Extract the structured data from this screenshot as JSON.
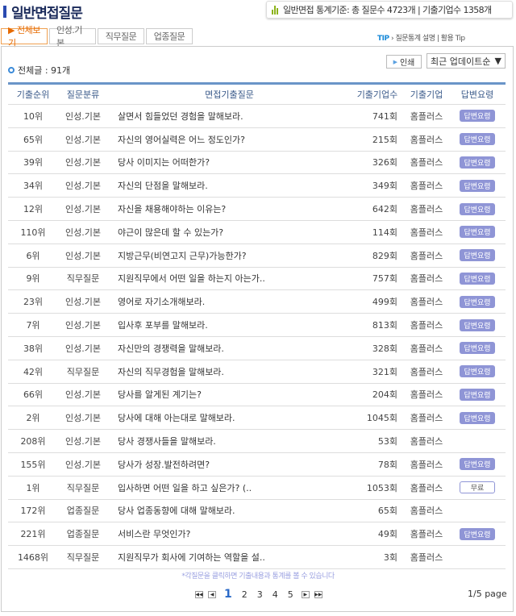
{
  "header": {
    "title": "일반면접질문",
    "stats": "일반면접 통계기준: 총 질문수 4723개 | 기출기업수 1358개"
  },
  "tabs": [
    {
      "label": "▶ 전체보기"
    },
    {
      "label": "인성.기본"
    },
    {
      "label": "직무질문"
    },
    {
      "label": "업종질문"
    }
  ],
  "tip": {
    "label": "TIP",
    "arrow": "›",
    "text": "질문통계 설명 | 활용 Tip"
  },
  "total": "전체글 : 91개",
  "print_label": "인쇄",
  "sort": {
    "selected": "최근 업데이트순"
  },
  "columns": [
    "기출순위",
    "질문분류",
    "면접기출질문",
    "기출기업수",
    "기출기업",
    "답변요령"
  ],
  "rows": [
    {
      "rank": "10위",
      "cat": "인성.기본",
      "q": "살면서 힘들었던 경험을 말해보라.",
      "count": "741회",
      "co": "홈플러스",
      "ans": "답변요령"
    },
    {
      "rank": "65위",
      "cat": "인성.기본",
      "q": "자신의 영어실력은 어느 정도인가?",
      "count": "215회",
      "co": "홈플러스",
      "ans": "답변요령"
    },
    {
      "rank": "39위",
      "cat": "인성.기본",
      "q": "당사 이미지는 어떠한가?",
      "count": "326회",
      "co": "홈플러스",
      "ans": "답변요령"
    },
    {
      "rank": "34위",
      "cat": "인성.기본",
      "q": "자신의 단점을 말해보라.",
      "count": "349회",
      "co": "홈플러스",
      "ans": "답변요령"
    },
    {
      "rank": "12위",
      "cat": "인성.기본",
      "q": "자신을 채용해야하는 이유는?",
      "count": "642회",
      "co": "홈플러스",
      "ans": "답변요령"
    },
    {
      "rank": "110위",
      "cat": "인성.기본",
      "q": "야근이 많은데 할 수 있는가?",
      "count": "114회",
      "co": "홈플러스",
      "ans": "답변요령"
    },
    {
      "rank": "6위",
      "cat": "인성.기본",
      "q": "지방근무(비연고지 근무)가능한가?",
      "count": "829회",
      "co": "홈플러스",
      "ans": "답변요령"
    },
    {
      "rank": "9위",
      "cat": "직무질문",
      "q": "지원직무에서 어떤 일을 하는지 아는가..",
      "count": "757회",
      "co": "홈플러스",
      "ans": "답변요령"
    },
    {
      "rank": "23위",
      "cat": "인성.기본",
      "q": "영어로 자기소개해보라.",
      "count": "499회",
      "co": "홈플러스",
      "ans": "답변요령"
    },
    {
      "rank": "7위",
      "cat": "인성.기본",
      "q": "입사후 포부를 말해보라.",
      "count": "813회",
      "co": "홈플러스",
      "ans": "답변요령"
    },
    {
      "rank": "38위",
      "cat": "인성.기본",
      "q": "자신만의 경쟁력을 말해보라.",
      "count": "328회",
      "co": "홈플러스",
      "ans": "답변요령"
    },
    {
      "rank": "42위",
      "cat": "직무질문",
      "q": "자신의 직무경험을 말해보라.",
      "count": "321회",
      "co": "홈플러스",
      "ans": "답변요령"
    },
    {
      "rank": "66위",
      "cat": "인성.기본",
      "q": "당사를 알게된 계기는?",
      "count": "204회",
      "co": "홈플러스",
      "ans": "답변요령"
    },
    {
      "rank": "2위",
      "cat": "인성.기본",
      "q": "당사에 대해 아는대로 말해보라.",
      "count": "1045회",
      "co": "홈플러스",
      "ans": "답변요령"
    },
    {
      "rank": "208위",
      "cat": "인성.기본",
      "q": "당사 경쟁사들을 말해보라.",
      "count": "53회",
      "co": "홈플러스",
      "ans": ""
    },
    {
      "rank": "155위",
      "cat": "인성.기본",
      "q": "당사가 성장.발전하려면?",
      "count": "78회",
      "co": "홈플러스",
      "ans": "답변요령"
    },
    {
      "rank": "1위",
      "cat": "직무질문",
      "q": "입사하면 어떤 일을 하고 싶은가? (..",
      "count": "1053회",
      "co": "홈플러스",
      "ans": "",
      "free": "무료"
    },
    {
      "rank": "172위",
      "cat": "업종질문",
      "q": "당사 업종동향에 대해 말해보라.",
      "count": "65회",
      "co": "홈플러스",
      "ans": ""
    },
    {
      "rank": "221위",
      "cat": "업종질문",
      "q": "서비스란 무엇인가?",
      "count": "49회",
      "co": "홈플러스",
      "ans": "답변요령"
    },
    {
      "rank": "1468위",
      "cat": "직무질문",
      "q": "지원직무가 회사에 기여하는 역할을 설..",
      "count": "3회",
      "co": "홈플러스",
      "ans": ""
    }
  ],
  "note": "*각질문을 클릭하면 기출내용과 통계를 볼 수 있습니다",
  "pager": {
    "pages": [
      "1",
      "2",
      "3",
      "4",
      "5"
    ],
    "current": "1",
    "info": "1/5 page"
  },
  "colors": {
    "accent": "#e66a00",
    "badge": "#8f95d6",
    "header_line": "#6a95c8"
  }
}
